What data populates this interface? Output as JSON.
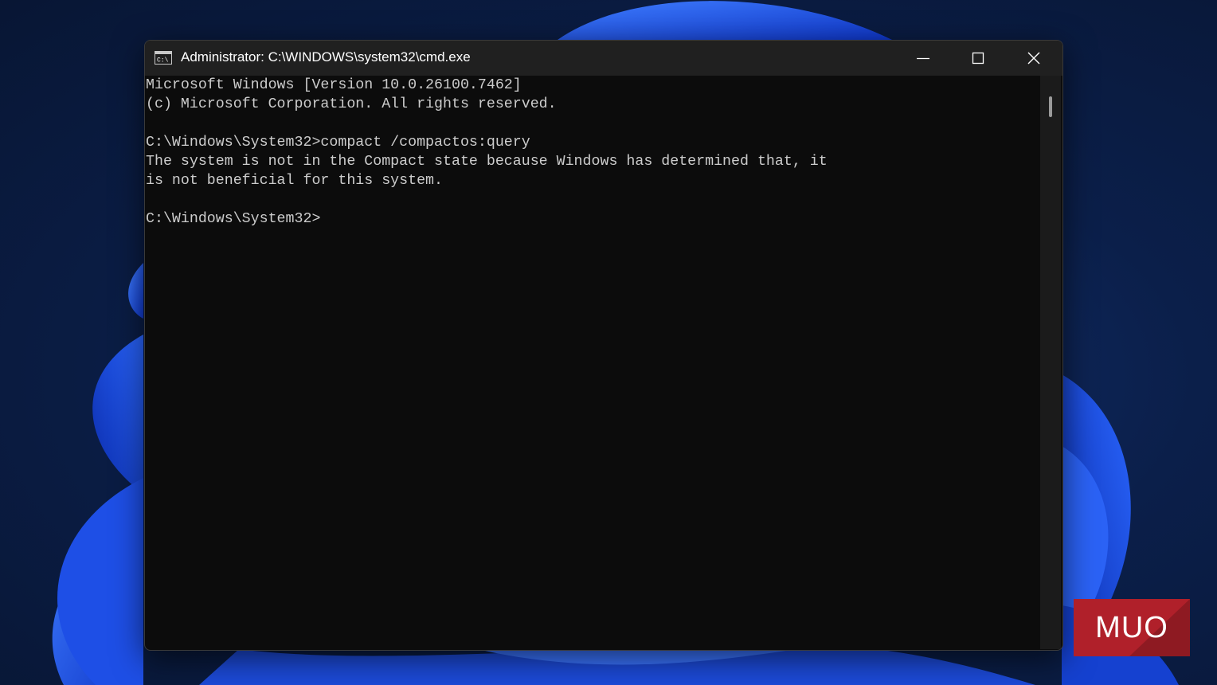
{
  "window": {
    "title": "Administrator: C:\\WINDOWS\\system32\\cmd.exe",
    "icon": "cmd-icon",
    "background_color": "#0c0c0c",
    "titlebar_color": "#202020",
    "text_color": "#cccccc",
    "controls": {
      "minimize": "minimize-icon",
      "maximize": "maximize-icon",
      "close": "close-icon"
    }
  },
  "console": {
    "lines": [
      "Microsoft Windows [Version 10.0.26100.7462]",
      "(c) Microsoft Corporation. All rights reserved.",
      "",
      "C:\\Windows\\System32>compact /compactos:query",
      "The system is not in the Compact state because Windows has determined that, it",
      "is not beneficial for this system.",
      "",
      "C:\\Windows\\System32>"
    ]
  },
  "watermark": {
    "text": "MUO",
    "color": "#c8232b"
  }
}
